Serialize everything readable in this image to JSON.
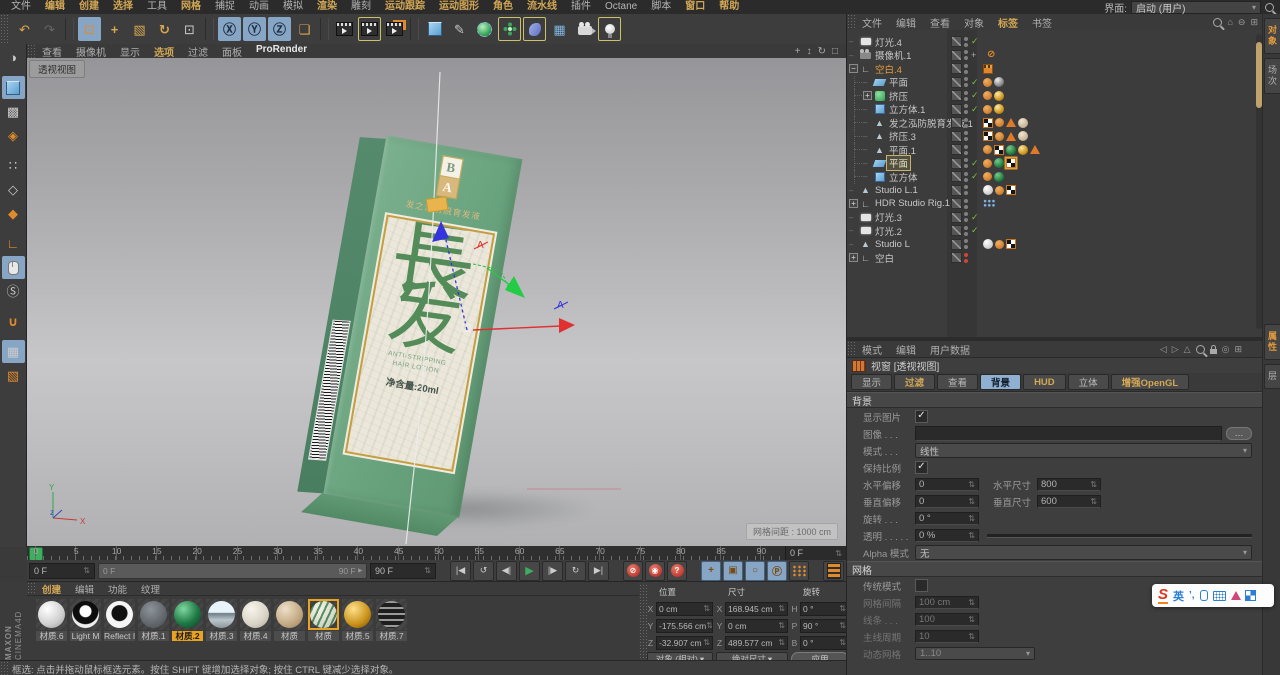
{
  "glyphs": {
    "check": "✓",
    "plus": "+",
    "minus": "−",
    "stepper": "⇅",
    "dd": "▾",
    "ellipsis": "…",
    "ban": "⊘",
    "target": "+",
    "dash": "–"
  },
  "menubar": {
    "items": [
      {
        "label": "文件",
        "accent": false
      },
      {
        "label": "编辑",
        "accent": true
      },
      {
        "label": "创建",
        "accent": true
      },
      {
        "label": "选择",
        "accent": true
      },
      {
        "label": "工具",
        "accent": false
      },
      {
        "label": "网格",
        "accent": true
      },
      {
        "label": "捕捉",
        "accent": false
      },
      {
        "label": "动画",
        "accent": false
      },
      {
        "label": "模拟",
        "accent": false
      },
      {
        "label": "渲染",
        "accent": true
      },
      {
        "label": "雕刻",
        "accent": false
      },
      {
        "label": "运动跟踪",
        "accent": true
      },
      {
        "label": "运动图形",
        "accent": true
      },
      {
        "label": "角色",
        "accent": true
      },
      {
        "label": "流水线",
        "accent": true
      },
      {
        "label": "插件",
        "accent": false
      },
      {
        "label": "Octane",
        "accent": false
      },
      {
        "label": "脚本",
        "accent": false
      },
      {
        "label": "窗口",
        "accent": true
      },
      {
        "label": "帮助",
        "accent": true
      }
    ],
    "interface_label": "界面:",
    "interface_value": "启动 (用户)"
  },
  "toolbar": {
    "icons": [
      {
        "name": "undo",
        "glyph": "↶",
        "cls": "g-gold"
      },
      {
        "name": "redo",
        "glyph": "↷",
        "cls": "g-dim"
      },
      {
        "name": "sep"
      },
      {
        "name": "live-selection",
        "glyph": "⊡",
        "cls": "g-orange",
        "bg": true
      },
      {
        "name": "move",
        "glyph": "+",
        "cls": "g-gold bold"
      },
      {
        "name": "scale",
        "glyph": "▧",
        "cls": "g-gold"
      },
      {
        "name": "rotate",
        "glyph": "↻",
        "cls": "g-gold bold"
      },
      {
        "name": "last-tool",
        "glyph": "⊡",
        "cls": "g-light"
      },
      {
        "name": "sep"
      },
      {
        "name": "lock-x",
        "glyph": "Ⓧ",
        "cls": "g-dark",
        "bg": true
      },
      {
        "name": "lock-y",
        "glyph": "Ⓨ",
        "cls": "g-dark",
        "bg": true
      },
      {
        "name": "lock-z",
        "glyph": "Ⓩ",
        "cls": "g-dark",
        "bg": true
      },
      {
        "name": "coord-system",
        "glyph": "❏",
        "cls": "g-gold"
      },
      {
        "name": "sep"
      },
      {
        "name": "render-view",
        "kind": "clap"
      },
      {
        "name": "render-to-picture-viewer",
        "kind": "clap",
        "boxed": true
      },
      {
        "name": "render-settings",
        "kind": "clap gear"
      },
      {
        "name": "sep"
      },
      {
        "name": "add-primitive",
        "kind": "cube"
      },
      {
        "name": "add-spline",
        "glyph": "✎",
        "cls": "g-light"
      },
      {
        "name": "add-generator",
        "kind": "sphg"
      },
      {
        "name": "add-mograph",
        "kind": "flower",
        "boxed": true
      },
      {
        "name": "add-deformer",
        "kind": "bend",
        "boxed": true
      },
      {
        "name": "add-floor",
        "glyph": "▦",
        "cls": "g-blue"
      },
      {
        "name": "add-camera",
        "kind": "cam"
      },
      {
        "name": "add-light",
        "kind": "bulb",
        "boxed": true
      },
      {
        "name": "flex"
      },
      {
        "name": "terrain-tool",
        "kind": "terrain"
      },
      {
        "name": "axis-center",
        "glyph": "✖",
        "cls": "g-orange"
      },
      {
        "name": "arrange-objects",
        "kind": "orb",
        "pressed": true
      }
    ]
  },
  "left_toolbar": {
    "icons": [
      {
        "name": "make-editable",
        "glyph": "◑",
        "cls": "g-light"
      },
      {
        "name": "gap"
      },
      {
        "name": "model-mode",
        "kind": "cube",
        "bg": true
      },
      {
        "name": "texture-mode",
        "glyph": "▩",
        "cls": "g-light"
      },
      {
        "name": "workplane-mode",
        "glyph": "◈",
        "cls": "g-orange"
      },
      {
        "name": "gap"
      },
      {
        "name": "points-mode",
        "glyph": "∷",
        "cls": "g-light"
      },
      {
        "name": "edges-mode",
        "glyph": "◇",
        "cls": "g-light"
      },
      {
        "name": "polygons-mode",
        "glyph": "◆",
        "cls": "g-orange"
      },
      {
        "name": "gap"
      },
      {
        "name": "axis-mode",
        "glyph": "∟",
        "cls": "g-orange bold"
      },
      {
        "name": "viewport-solo",
        "kind": "mouse",
        "bg": true
      },
      {
        "name": "snap-mode",
        "glyph": "Ⓢ",
        "cls": "g-light"
      },
      {
        "name": "gap"
      },
      {
        "name": "magnet-tool",
        "glyph": "∪",
        "cls": "g-orange bold"
      },
      {
        "name": "gap"
      },
      {
        "name": "workplane-lock",
        "glyph": "▦",
        "cls": "g-light",
        "bg": true
      },
      {
        "name": "workplane-snap",
        "glyph": "▧",
        "cls": "g-orange"
      }
    ]
  },
  "viewport": {
    "menu": [
      {
        "label": "查看"
      },
      {
        "label": "摄像机"
      },
      {
        "label": "显示"
      },
      {
        "label": "选项",
        "accent": true
      },
      {
        "label": "过滤"
      },
      {
        "label": "面板"
      },
      {
        "label": "ProRender",
        "bright": true
      }
    ],
    "nav_icons": [
      {
        "name": "pan",
        "glyph": "+"
      },
      {
        "name": "dolly",
        "glyph": "↕"
      },
      {
        "name": "orbit",
        "glyph": "↻"
      },
      {
        "name": "toggle-view",
        "glyph": "□"
      }
    ],
    "view_tab": "透视视图",
    "grid_info": "网格间距 : 1000 cm",
    "package": {
      "logo_top": "B",
      "logo_bottom": "A",
      "title": "发之泓防脱育发液",
      "hanzi_top": "長",
      "hanzi_bottom": "发",
      "en1": "ANTI-STRIPPING",
      "en2": "HAIR LOTION",
      "net": "净含量:20ml"
    },
    "gizmo": {
      "label_red": "A",
      "label_blue": "A"
    },
    "axis": {
      "x": "X",
      "y": "Y",
      "z": "z"
    }
  },
  "timeline": {
    "ticks": [
      "0",
      "5",
      "10",
      "15",
      "20",
      "25",
      "30",
      "35",
      "40",
      "45",
      "50",
      "55",
      "60",
      "65",
      "70",
      "75",
      "80",
      "85",
      "90"
    ],
    "frame_box": "0 F",
    "start_field": "0 F",
    "end_field": "90 F",
    "scrub_left": "0 F",
    "scrub_right": "90 F",
    "buttons": [
      {
        "name": "goto-start",
        "glyph": "|◀"
      },
      {
        "name": "play-backward",
        "glyph": "↺"
      },
      {
        "name": "previous-frame",
        "glyph": "◀|"
      },
      {
        "name": "play-forward",
        "glyph": "▶",
        "play": true
      },
      {
        "name": "next-frame",
        "glyph": "|▶"
      },
      {
        "name": "play-loop",
        "glyph": "↻"
      },
      {
        "name": "goto-end",
        "glyph": "▶|"
      }
    ],
    "records": [
      {
        "name": "record-keyframe",
        "glyph": "⊘"
      },
      {
        "name": "autokeying",
        "glyph": "◉"
      },
      {
        "name": "keyframe-selection",
        "glyph": "?"
      }
    ],
    "toggles": [
      {
        "name": "key-position",
        "glyph": "+"
      },
      {
        "name": "key-scale",
        "glyph": "▣"
      },
      {
        "name": "key-rotation",
        "glyph": "○"
      },
      {
        "name": "key-parameter",
        "glyph": "Ⓟ"
      },
      {
        "name": "key-pla",
        "kind": "dots",
        "gray": true
      }
    ]
  },
  "materials": {
    "menu": [
      {
        "label": "创建",
        "accent": true
      },
      {
        "label": "编辑"
      },
      {
        "label": "功能"
      },
      {
        "label": "纹理"
      }
    ],
    "items": [
      {
        "name": "材质.6",
        "style": "white"
      },
      {
        "name": "Light M",
        "style": "lightm"
      },
      {
        "name": "Reflect I",
        "style": "reflect"
      },
      {
        "name": "材质.1",
        "style": "trans"
      },
      {
        "name": "材质.2",
        "style": "green",
        "label_selected": true
      },
      {
        "name": "材质.3",
        "style": "chrome"
      },
      {
        "name": "材质.4",
        "style": "ivory"
      },
      {
        "name": "材质",
        "style": "beige"
      },
      {
        "name": "材质",
        "style": "pattern",
        "border_selected": true
      },
      {
        "name": "材质.5",
        "style": "gold"
      },
      {
        "name": "材质.7",
        "style": "striped"
      }
    ]
  },
  "coords": {
    "cols": [
      {
        "header": "位置",
        "rows": [
          {
            "axis": "X",
            "value": "0 cm"
          },
          {
            "axis": "Y",
            "value": "-175.566 cm"
          },
          {
            "axis": "Z",
            "value": "-32.907 cm"
          }
        ]
      },
      {
        "header": "尺寸",
        "rows": [
          {
            "axis": "X",
            "value": "168.945 cm"
          },
          {
            "axis": "Y",
            "value": "0 cm"
          },
          {
            "axis": "Z",
            "value": "489.577 cm"
          }
        ]
      },
      {
        "header": "旋转",
        "rows": [
          {
            "axis": "H",
            "value": "0 °"
          },
          {
            "axis": "P",
            "value": "90 °"
          },
          {
            "axis": "B",
            "value": "0 °"
          }
        ]
      }
    ],
    "mode1": "对象 (相对)",
    "mode2": "绝对尺寸",
    "apply": "应用"
  },
  "statusbar": {
    "text": "框选: 点击并拖动鼠标框选元素。按住 SHIFT 键增加选择对象; 按住 CTRL 键减少选择对象。"
  },
  "branding": {
    "line1": "MAXON",
    "line2": "CINEMA4D"
  },
  "object_manager": {
    "menu": [
      {
        "label": "文件"
      },
      {
        "label": "编辑"
      },
      {
        "label": "查看"
      },
      {
        "label": "对象"
      },
      {
        "label": "标签",
        "accent": true
      },
      {
        "label": "书签"
      }
    ],
    "header_icons": [
      {
        "name": "search",
        "kind": "mag"
      },
      {
        "name": "home",
        "glyph": "⌂"
      },
      {
        "name": "collapse",
        "glyph": "⊖"
      },
      {
        "name": "expand",
        "glyph": "⊞"
      }
    ],
    "side_tabs": [
      {
        "label": "对象",
        "active": true
      },
      {
        "label": "场次"
      }
    ],
    "items": [
      {
        "name": "灯光.4",
        "icon": "light",
        "check": true,
        "tags": []
      },
      {
        "name": "摄像机.1",
        "icon": "cam",
        "target": true,
        "tags": [
          "ban"
        ]
      },
      {
        "name": "空白.4",
        "icon": "null",
        "expand": "minus",
        "color": "orange",
        "tags": [
          "film"
        ]
      },
      {
        "name": "平面",
        "icon": "plane",
        "depth": 1,
        "check": true,
        "tags": [
          "ball",
          "metal"
        ]
      },
      {
        "name": "挤压",
        "icon": "ext",
        "depth": 1,
        "expand": "plus",
        "check": true,
        "tags": [
          "ball",
          "gold"
        ]
      },
      {
        "name": "立方体.1",
        "icon": "cube",
        "depth": 1,
        "check": true,
        "tags": [
          "ball",
          "gold"
        ]
      },
      {
        "name": "发之泓防脱育发液.1",
        "icon": "fig",
        "depth": 1,
        "tags": [
          "checker",
          "ball",
          "triangle",
          "beige"
        ]
      },
      {
        "name": "挤压.3",
        "icon": "fig",
        "depth": 1,
        "tags": [
          "checker",
          "ball",
          "triangle",
          "beige"
        ]
      },
      {
        "name": "平面.1",
        "icon": "fig",
        "depth": 1,
        "tags": [
          "ball",
          "checker",
          "green",
          "gold",
          "triangle"
        ]
      },
      {
        "name": "平面",
        "icon": "plane",
        "depth": 1,
        "check": true,
        "selected": true,
        "tags": [
          "ball",
          "green",
          "checker-boxed"
        ]
      },
      {
        "name": "立方体",
        "icon": "cube",
        "depth": 1,
        "check": true,
        "tags": [
          "ball",
          "green"
        ]
      },
      {
        "name": "Studio L.1",
        "icon": "fig",
        "tags": [
          "white",
          "ball",
          "checker"
        ]
      },
      {
        "name": "HDR Studio Rig.1",
        "icon": "null",
        "expand": "plus",
        "tags": [
          "hdr"
        ]
      },
      {
        "name": "灯光.3",
        "icon": "light",
        "check": true,
        "tags": []
      },
      {
        "name": "灯光.2",
        "icon": "light",
        "check": true,
        "tags": []
      },
      {
        "name": "Studio L",
        "icon": "fig",
        "tags": [
          "white",
          "ball",
          "checker"
        ]
      },
      {
        "name": "空白",
        "icon": "null",
        "expand": "plus",
        "dots": "red",
        "tags": []
      }
    ]
  },
  "attributes": {
    "menu": [
      {
        "label": "模式"
      },
      {
        "label": "编辑"
      },
      {
        "label": "用户数据"
      }
    ],
    "header_icons": [
      {
        "name": "back",
        "glyph": "◁"
      },
      {
        "name": "forward",
        "glyph": "▷"
      },
      {
        "name": "up",
        "glyph": "△"
      },
      {
        "name": "search",
        "kind": "mag"
      },
      {
        "name": "lock",
        "kind": "lock"
      },
      {
        "name": "track",
        "glyph": "◎"
      },
      {
        "name": "new-window",
        "glyph": "⊞"
      }
    ],
    "title": "视窗 [透视视图]",
    "tabs": [
      {
        "label": "显示"
      },
      {
        "label": "过滤",
        "accent": true
      },
      {
        "label": "查看"
      },
      {
        "label": "背景",
        "active": true
      },
      {
        "label": "HUD",
        "accent": true
      },
      {
        "label": "立体"
      },
      {
        "label": "增强OpenGL",
        "accent": true
      }
    ],
    "side_tabs": [
      {
        "label": "属性",
        "active": true
      },
      {
        "label": "层"
      }
    ],
    "bg_section": "背景",
    "f_show_image": "显示图片",
    "f_image": "图像 . . .",
    "f_mode": "模式 . . .",
    "v_mode": "线性",
    "f_keep_ratio": "保持比例",
    "f_h_off": "水平偏移",
    "v_h_off": "0",
    "f_h_size": "水平尺寸",
    "v_h_size": "800",
    "f_v_off": "垂直偏移",
    "v_v_off": "0",
    "f_v_size": "垂直尺寸",
    "v_v_size": "600",
    "f_rot": "旋转 . . .",
    "v_rot": "0 °",
    "f_trans": "透明 . . . . .",
    "v_trans": "0 %",
    "f_alpha": "Alpha 模式",
    "v_alpha": "无",
    "grid_section": "网格",
    "f_legacy": "传统模式",
    "f_spacing": "网格间隔",
    "v_spacing": "100 cm",
    "f_lines": "线条 . . .",
    "v_lines": "100",
    "f_major": "主线周期",
    "v_major": "10",
    "f_dyn": "动态网格",
    "v_dyn": "1..10"
  },
  "ime": {
    "logo": "S",
    "mode": "英",
    "punc": "’,"
  }
}
